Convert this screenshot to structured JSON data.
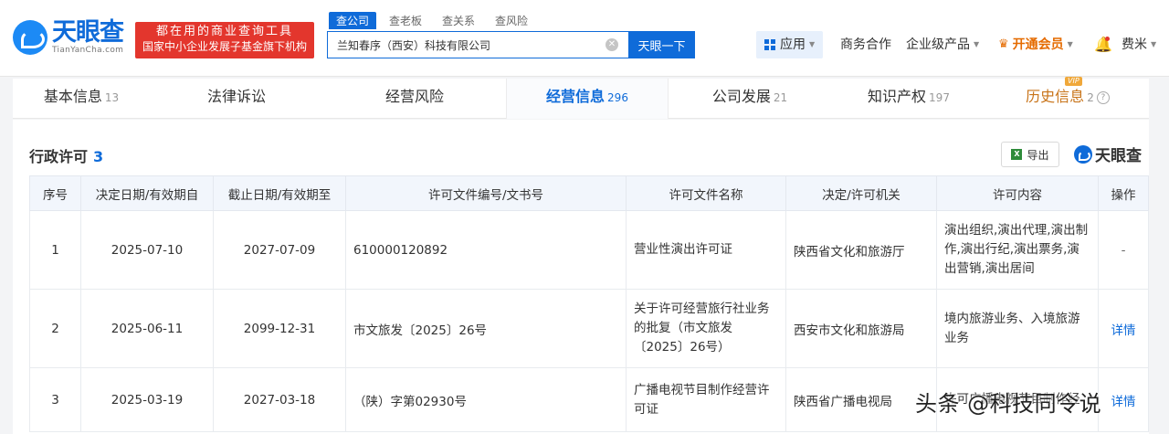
{
  "header": {
    "logo_cn": "天眼查",
    "logo_en": "TianYanCha.com",
    "slogan_line1": "都在用的商业查询工具",
    "slogan_line2": "国家中小企业发展子基金旗下机构",
    "search_tabs": [
      "查公司",
      "查老板",
      "查关系",
      "查风险"
    ],
    "search_value": "兰知春序（西安）科技有限公司",
    "search_button": "天眼一下",
    "nav": {
      "apps": "应用",
      "business": "商务合作",
      "enterprise": "企业级产品",
      "vip": "开通会员",
      "user": "费米"
    }
  },
  "tabs": [
    {
      "label": "基本信息",
      "count": "13"
    },
    {
      "label": "法律诉讼",
      "count": ""
    },
    {
      "label": "经营风险",
      "count": ""
    },
    {
      "label": "经营信息",
      "count": "296"
    },
    {
      "label": "公司发展",
      "count": "21"
    },
    {
      "label": "知识产权",
      "count": "197"
    },
    {
      "label": "历史信息",
      "count": "2",
      "badge": "VIP"
    }
  ],
  "section": {
    "title": "行政许可",
    "count": "3",
    "export_label": "导出",
    "brand": "天眼查"
  },
  "table": {
    "headers": [
      "序号",
      "决定日期/有效期自",
      "截止日期/有效期至",
      "许可文件编号/文书号",
      "许可文件名称",
      "决定/许可机关",
      "许可内容",
      "操作"
    ],
    "rows": [
      {
        "no": "1",
        "start": "2025-07-10",
        "end": "2027-07-09",
        "doc_no": "610000120892",
        "doc_name": "营业性演出许可证",
        "authority": "陕西省文化和旅游厅",
        "content": "演出组织,演出代理,演出制作,演出行纪,演出票务,演出营销,演出居间",
        "op": "-"
      },
      {
        "no": "2",
        "start": "2025-06-11",
        "end": "2099-12-31",
        "doc_no": "市文旅发〔2025〕26号",
        "doc_name": "关于许可经营旅行社业务的批复（市文旅发〔2025〕26号）",
        "authority": "西安市文化和旅游局",
        "content": "境内旅游业务、入境旅游业务",
        "op": "详情"
      },
      {
        "no": "3",
        "start": "2025-03-19",
        "end": "2027-03-18",
        "doc_no": "（陕）字第02930号",
        "doc_name": "广播电视节目制作经营许可证",
        "authority": "陕西省广播电视局",
        "content": "许可广播电视节目制作经",
        "op": "详情"
      }
    ]
  },
  "watermark": "头条 @科技同令说",
  "icons": [
    "logo-icon",
    "clear-icon",
    "grid-icon",
    "crown-icon",
    "bell-icon",
    "help-icon",
    "excel-icon"
  ],
  "colors": {
    "brand_blue": "#0f6bd9",
    "slogan_red": "#e3362d",
    "vip_orange": "#e56b00"
  }
}
